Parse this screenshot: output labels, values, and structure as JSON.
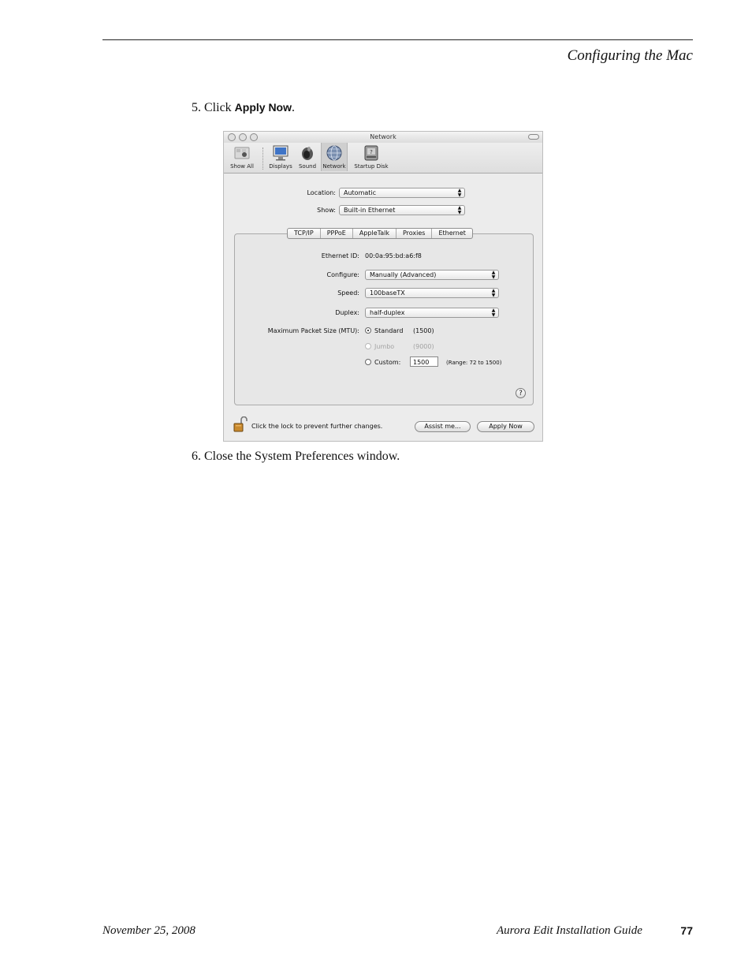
{
  "header": {
    "title": "Configuring the Mac"
  },
  "steps": {
    "step5_prefix": "5. Click ",
    "step5_ui": "Apply Now",
    "step5_suffix": ".",
    "step6": "6. Close the System Preferences window."
  },
  "window": {
    "title": "Network",
    "toolbar": [
      "Show All",
      "Displays",
      "Sound",
      "Network",
      "Startup Disk"
    ],
    "location_label": "Location:",
    "location_value": "Automatic",
    "show_label": "Show:",
    "show_value": "Built-in Ethernet",
    "tabs": [
      "TCP/IP",
      "PPPoE",
      "AppleTalk",
      "Proxies",
      "Ethernet"
    ],
    "selected_tab": "Ethernet",
    "ethernet_id_label": "Ethernet ID:",
    "ethernet_id_value": "00:0a:95:bd:a6:f8",
    "configure_label": "Configure:",
    "configure_value": "Manually (Advanced)",
    "speed_label": "Speed:",
    "speed_value": "100baseTX",
    "duplex_label": "Duplex:",
    "duplex_value": "half-duplex",
    "mtu_label": "Maximum Packet Size (MTU):",
    "mtu_standard": "Standard",
    "mtu_standard_value": "(1500)",
    "mtu_jumbo": "Jumbo",
    "mtu_jumbo_value": "(9000)",
    "mtu_custom": "Custom:",
    "mtu_custom_value": "1500",
    "mtu_range": "(Range: 72 to 1500)",
    "help_glyph": "?",
    "lock_text": "Click the lock to prevent further changes.",
    "assist_button": "Assist me...",
    "apply_button": "Apply Now"
  },
  "footer": {
    "date": "November 25, 2008",
    "doc_title": "Aurora Edit Installation Guide",
    "page_number": "77"
  }
}
